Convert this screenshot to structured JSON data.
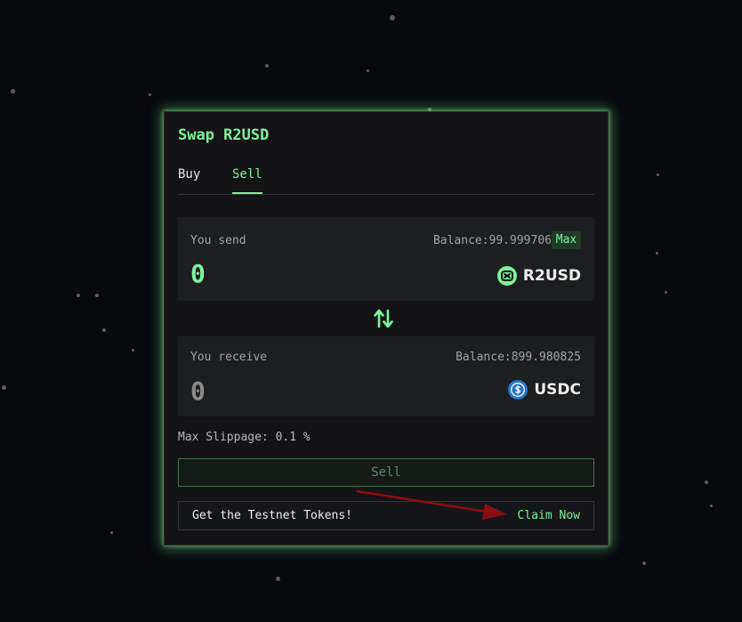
{
  "swap": {
    "title": "Swap R2USD",
    "tabs": {
      "buy": "Buy",
      "sell": "Sell",
      "active": "Sell"
    },
    "send": {
      "label": "You send",
      "balance_text": "Balance:99.999706",
      "max_label": "Max",
      "amount": "0",
      "token": {
        "name": "R2USD",
        "icon": "r2usd-token-icon"
      }
    },
    "switch_icon": "swap-direction-icon",
    "receive": {
      "label": "You receive",
      "balance_text": "Balance:899.980825",
      "amount": "0",
      "token": {
        "name": "USDC",
        "icon": "usdc-token-icon"
      }
    },
    "slippage_text": "Max Slippage: 0.1 %",
    "action_button": "Sell",
    "faucet": {
      "text": "Get the Testnet Tokens!",
      "link": "Claim Now"
    }
  },
  "colors": {
    "accent": "#7ef29a",
    "background": "#07090d",
    "card": "#141417",
    "panel": "#1d1e20",
    "usdc": "#2775ca",
    "annotation_arrow": "#8b0d12"
  }
}
